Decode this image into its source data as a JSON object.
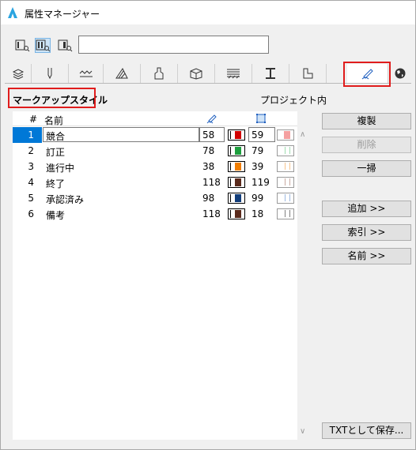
{
  "window": {
    "title": "属性マネージャー"
  },
  "toolbar": {
    "view_buttons": [
      "list-view-icon",
      "split-view-icon",
      "detail-view-icon"
    ],
    "search_value": ""
  },
  "tabs": [
    "layers-icon",
    "pen-icon",
    "line-type-icon",
    "fill-icon",
    "paint-icon",
    "building-material-icon",
    "surface-icon",
    "profile-icon",
    "zone-icon",
    "markup-style-icon",
    "globe-icon"
  ],
  "section": {
    "heading": "マークアップスタイル",
    "scope": "プロジェクト内"
  },
  "table": {
    "headers": {
      "num": "#",
      "name": "名前"
    },
    "rows": [
      {
        "num": "1",
        "name": "競合",
        "pen1": "58",
        "pen2": "59",
        "color": "#d00000",
        "faint": "#f4a0a0",
        "selected": true
      },
      {
        "num": "2",
        "name": "訂正",
        "pen1": "78",
        "pen2": "79",
        "color": "#1e9e3e",
        "faint": "#9fdcb0",
        "selected": false
      },
      {
        "num": "3",
        "name": "進行中",
        "pen1": "38",
        "pen2": "39",
        "color": "#f07d00",
        "faint": "#f8c48c",
        "selected": false
      },
      {
        "num": "4",
        "name": "終了",
        "pen1": "118",
        "pen2": "119",
        "color": "#5a2a1c",
        "faint": "#c9a9a0",
        "selected": false
      },
      {
        "num": "5",
        "name": "承認済み",
        "pen1": "98",
        "pen2": "99",
        "color": "#123d7a",
        "faint": "#9cb8e0",
        "selected": false
      },
      {
        "num": "6",
        "name": "備考",
        "pen1": "118",
        "pen2": "18",
        "color": "#5a2a1c",
        "faint": "#808080",
        "selected": false
      }
    ]
  },
  "buttons": {
    "duplicate": "複製",
    "delete": "削除",
    "purge": "一掃",
    "append": "追加 >>",
    "index": "索引 >>",
    "rename": "名前 >>",
    "save_txt": "TXTとして保存..."
  },
  "colors": {
    "highlight": "#e01c1c",
    "selection": "#0078d7"
  }
}
